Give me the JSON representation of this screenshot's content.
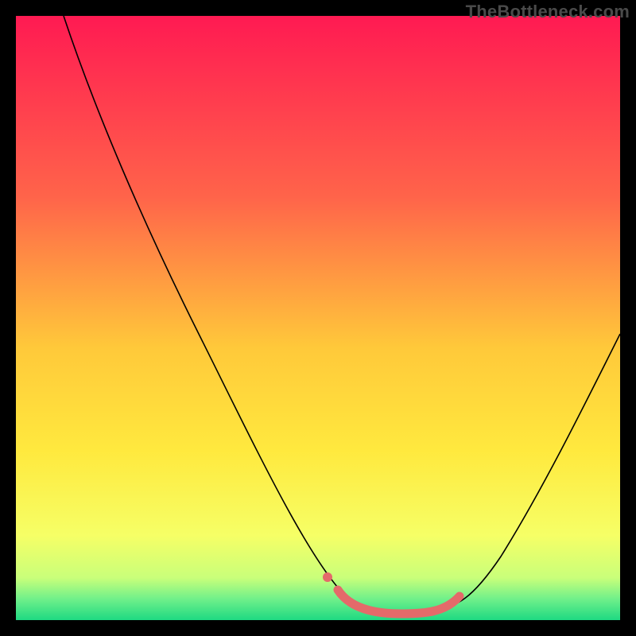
{
  "watermark": "TheBottleneck.com",
  "chart_data": {
    "type": "line",
    "title": "",
    "xlabel": "",
    "ylabel": "",
    "xlim": [
      0,
      100
    ],
    "ylim": [
      0,
      100
    ],
    "grid": false,
    "legend": false,
    "background_gradient_stops": [
      {
        "offset": 0.0,
        "color": "#ff1a52"
      },
      {
        "offset": 0.3,
        "color": "#ff644a"
      },
      {
        "offset": 0.55,
        "color": "#ffc93a"
      },
      {
        "offset": 0.72,
        "color": "#ffe93e"
      },
      {
        "offset": 0.86,
        "color": "#f6ff66"
      },
      {
        "offset": 0.93,
        "color": "#c9ff7a"
      },
      {
        "offset": 0.965,
        "color": "#70f08a"
      },
      {
        "offset": 1.0,
        "color": "#1ed982"
      }
    ],
    "series": [
      {
        "name": "bottleneck-curve",
        "stroke": "#000000",
        "stroke_width": 1.5,
        "x": [
          8,
          12,
          18,
          24,
          30,
          36,
          42,
          48,
          52,
          56,
          60,
          64,
          68,
          72,
          76,
          80,
          84,
          88,
          92,
          96,
          100
        ],
        "y": [
          100,
          92,
          80,
          68,
          56,
          44,
          32,
          20,
          12,
          6,
          3,
          2,
          2,
          3,
          6,
          12,
          20,
          30,
          40,
          50,
          60
        ]
      },
      {
        "name": "highlight-band",
        "stroke": "#e46a6a",
        "stroke_width": 8,
        "x": [
          54,
          58,
          62,
          66,
          70,
          72
        ],
        "y": [
          5,
          2.5,
          2,
          2,
          2.5,
          5
        ]
      }
    ]
  }
}
